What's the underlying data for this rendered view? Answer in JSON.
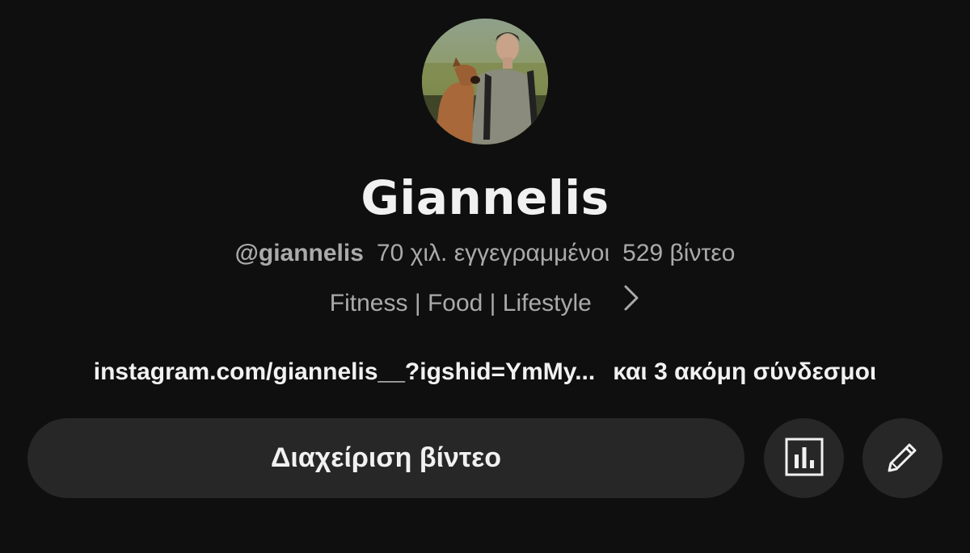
{
  "profile": {
    "avatar_alt": "Channel avatar: man walking with dog outdoors",
    "channel_name": "Giannelis",
    "handle": "@giannelis",
    "subscribers": "70 χιλ. εγγεγραμμένοι",
    "videos": "529 βίντεο",
    "description": "Fitness | Food | Lifestyle",
    "link_primary": "instagram.com/giannelis__?igshid=YmMy...",
    "link_more": "και 3 ακόμη σύνδεσμοι"
  },
  "actions": {
    "manage_videos_label": "Διαχείριση βίντεο",
    "analytics_icon": "bar-chart-icon",
    "edit_icon": "pencil-icon"
  },
  "icons": {
    "description_expand": "chevron-right-icon"
  },
  "colors": {
    "background": "#0f0f0f",
    "button_background": "#272727",
    "primary_text": "#f1f1f1",
    "secondary_text": "#aaaaaa"
  }
}
